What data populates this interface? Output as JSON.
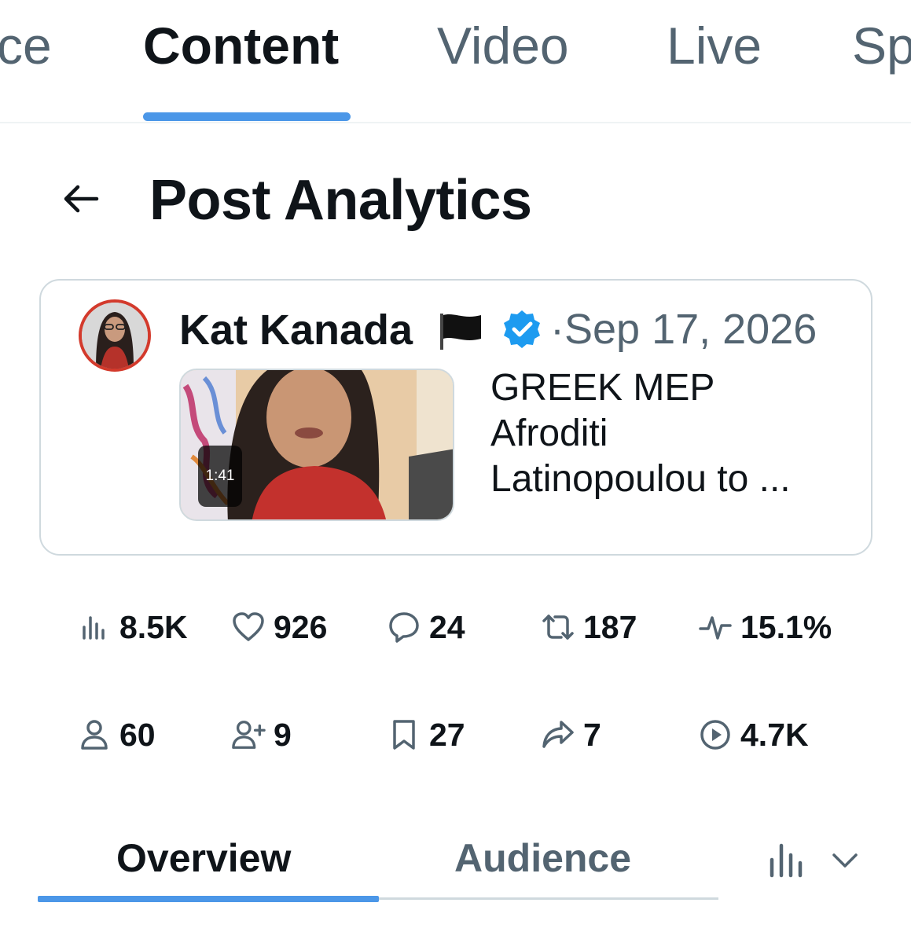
{
  "top_tabs": {
    "items": [
      {
        "label": "ce"
      },
      {
        "label": "Content"
      },
      {
        "label": "Video"
      },
      {
        "label": "Live"
      },
      {
        "label": "Sp"
      }
    ],
    "active_index": 1
  },
  "header": {
    "back_icon": "arrow-left-icon",
    "title": "Post Analytics"
  },
  "post": {
    "author": "Kat Kanada",
    "author_badge": "black-flag-emoji",
    "verified": true,
    "date_separator": "·",
    "date": "Sep 17, 2026",
    "video_duration": "1:41",
    "text_lines": [
      "GREEK MEP",
      "Afroditi",
      "Latinopoulou to ..."
    ]
  },
  "metrics": {
    "impressions": {
      "icon": "bar-chart-icon",
      "value": "8.5K"
    },
    "likes": {
      "icon": "heart-icon",
      "value": "926"
    },
    "replies": {
      "icon": "reply-icon",
      "value": "24"
    },
    "reposts": {
      "icon": "repost-icon",
      "value": "187"
    },
    "engagement_rate": {
      "icon": "pulse-icon",
      "value": "15.1%"
    },
    "profile_visits": {
      "icon": "person-icon",
      "value": "60"
    },
    "follows": {
      "icon": "person-add-icon",
      "value": "9"
    },
    "bookmarks": {
      "icon": "bookmark-icon",
      "value": "27"
    },
    "shares": {
      "icon": "share-icon",
      "value": "7"
    },
    "video_views": {
      "icon": "play-circle-icon",
      "value": "4.7K"
    }
  },
  "bottom_tabs": {
    "items": [
      {
        "label": "Overview"
      },
      {
        "label": "Audience"
      }
    ],
    "active_index": 0,
    "chart_icon": "bar-chart-icon",
    "dropdown_icon": "chevron-down-icon"
  },
  "colors": {
    "accent": "#4b97e8",
    "text_primary": "#0f1419",
    "text_secondary": "#536471",
    "border": "#cfd9de",
    "verified": "#1d9bf0"
  }
}
